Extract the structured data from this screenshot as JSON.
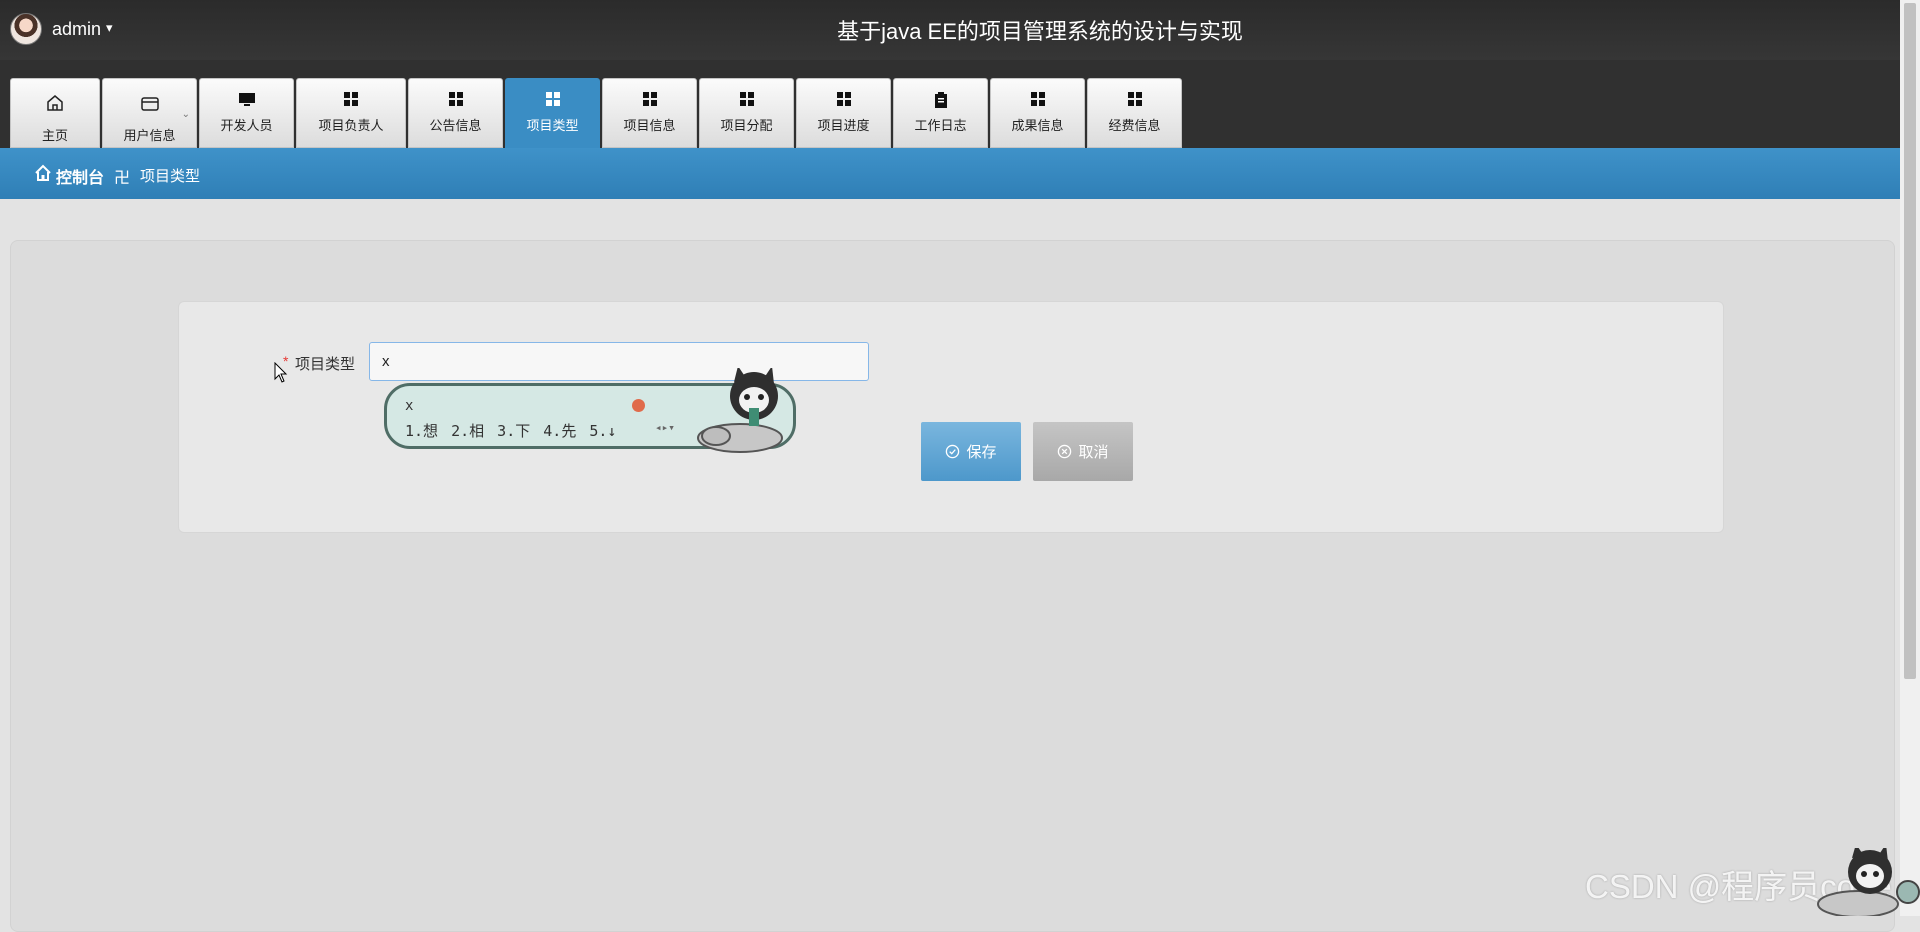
{
  "header": {
    "username": "admin",
    "user_caret": "▾",
    "title": "基于java EE的项目管理系统的设计与实现"
  },
  "nav": {
    "tabs": [
      {
        "label": "主页",
        "icon": "home-icon"
      },
      {
        "label": "用户信息",
        "icon": "wallet-icon",
        "has_dropdown": true
      },
      {
        "label": "开发人员",
        "icon": "monitor-icon"
      },
      {
        "label": "项目负责人",
        "icon": "grid-icon"
      },
      {
        "label": "公告信息",
        "icon": "grid-icon"
      },
      {
        "label": "项目类型",
        "icon": "grid-icon",
        "active": true
      },
      {
        "label": "项目信息",
        "icon": "grid-icon"
      },
      {
        "label": "项目分配",
        "icon": "grid-icon"
      },
      {
        "label": "项目进度",
        "icon": "grid-icon"
      },
      {
        "label": "工作日志",
        "icon": "clipboard-icon"
      },
      {
        "label": "成果信息",
        "icon": "grid-icon"
      },
      {
        "label": "经费信息",
        "icon": "grid-icon"
      }
    ],
    "dropdown_caret": "⌄"
  },
  "breadcrumb": {
    "home": "控制台",
    "separator": "卍",
    "current": "项目类型"
  },
  "form": {
    "required_mark": "*",
    "field_label": "项目类型",
    "field_value": "x",
    "save_label": "保存",
    "cancel_label": "取消"
  },
  "ime": {
    "composition": "x",
    "candidates": "1.想  2.相  3.下  4.先  5.↓",
    "nav_arrows": "◂▸▾"
  },
  "watermark": "CSDN @程序员code",
  "colors": {
    "accent": "#3a8dc4",
    "topbar": "#2f2f2f",
    "required": "#e53935"
  }
}
